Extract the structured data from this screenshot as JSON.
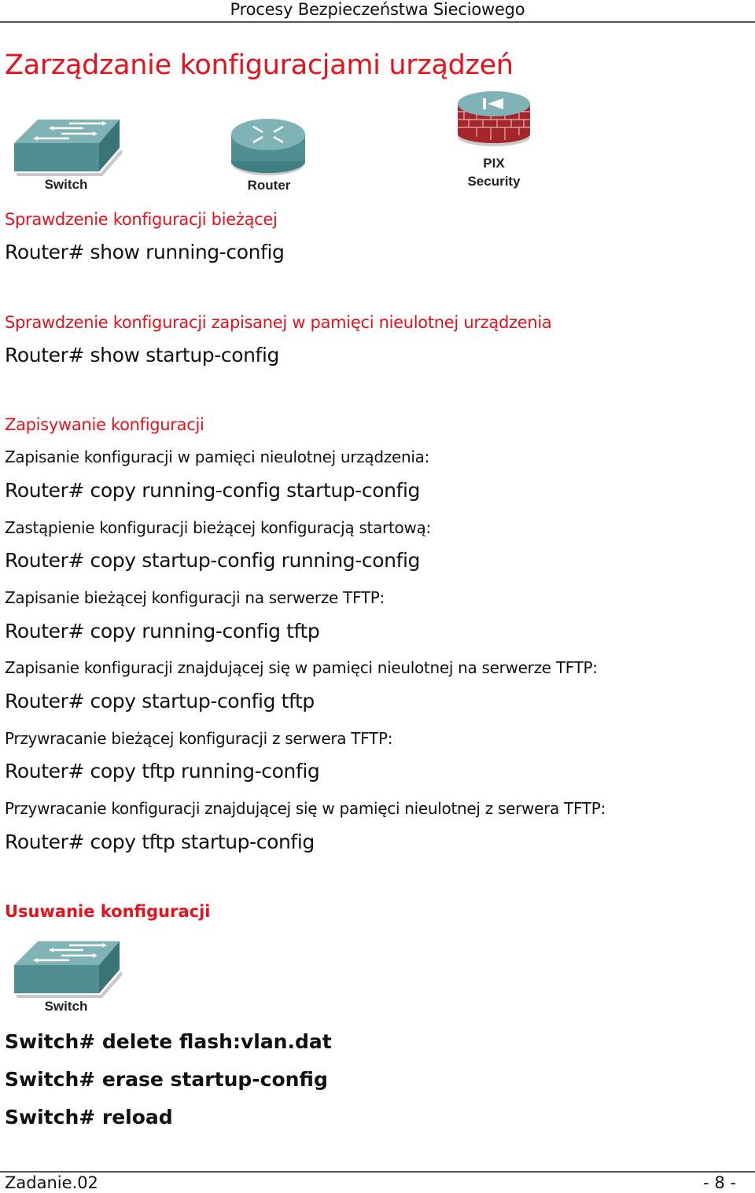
{
  "header": {
    "title": "Procesy Bezpieczeństwa Sieciowego"
  },
  "page_title": "Zarządzanie konfiguracjami urządzeń",
  "devices_top": [
    {
      "icon": "switch-icon",
      "label": "Switch"
    },
    {
      "icon": "router-icon",
      "label": "Router"
    },
    {
      "icon": "pix-firewall-icon",
      "label_line1": "PIX",
      "label_line2": "Security"
    }
  ],
  "sections": {
    "check_running": {
      "heading": "Sprawdzenie konfiguracji bieżącej",
      "command": "Router# show running-config"
    },
    "check_startup": {
      "heading": "Sprawdzenie konfiguracji zapisanej w pamięci nieulotnej urządzenia",
      "command": "Router# show startup-config"
    },
    "saving": {
      "heading": "Zapisywanie konfiguracji",
      "items": [
        {
          "description": "Zapisanie konfiguracji w pamięci nieulotnej urządzenia:",
          "command": "Router# copy running-config startup-config"
        },
        {
          "description": "Zastąpienie konfiguracji bieżącej konfiguracją startową:",
          "command": "Router# copy startup-config running-config"
        },
        {
          "description": "Zapisanie bieżącej konfiguracji na serwerze TFTP:",
          "command": "Router# copy running-config tftp"
        },
        {
          "description": "Zapisanie konfiguracji znajdującej się w pamięci nieulotnej na serwerze TFTP:",
          "command": "Router# copy startup-config tftp"
        },
        {
          "description": "Przywracanie bieżącej konfiguracji z serwera TFTP:",
          "command": "Router# copy tftp running-config"
        },
        {
          "description": "Przywracanie konfiguracji znajdującej się w pamięci nieulotnej z serwera TFTP:",
          "command": "Router# copy tftp startup-config"
        }
      ]
    },
    "deleting": {
      "heading": "Usuwanie konfiguracji",
      "device": {
        "icon": "switch-icon",
        "label": "Switch"
      },
      "commands": [
        "Switch# delete flash:vlan.dat",
        "Switch# erase startup-config",
        "Switch# reload"
      ]
    }
  },
  "footer": {
    "left": "Zadanie.02",
    "page": "- 8 -"
  },
  "colors": {
    "accent_red": "#e8101a",
    "device_teal": "#4f8f92",
    "firewall_brick": "#a3262b"
  }
}
